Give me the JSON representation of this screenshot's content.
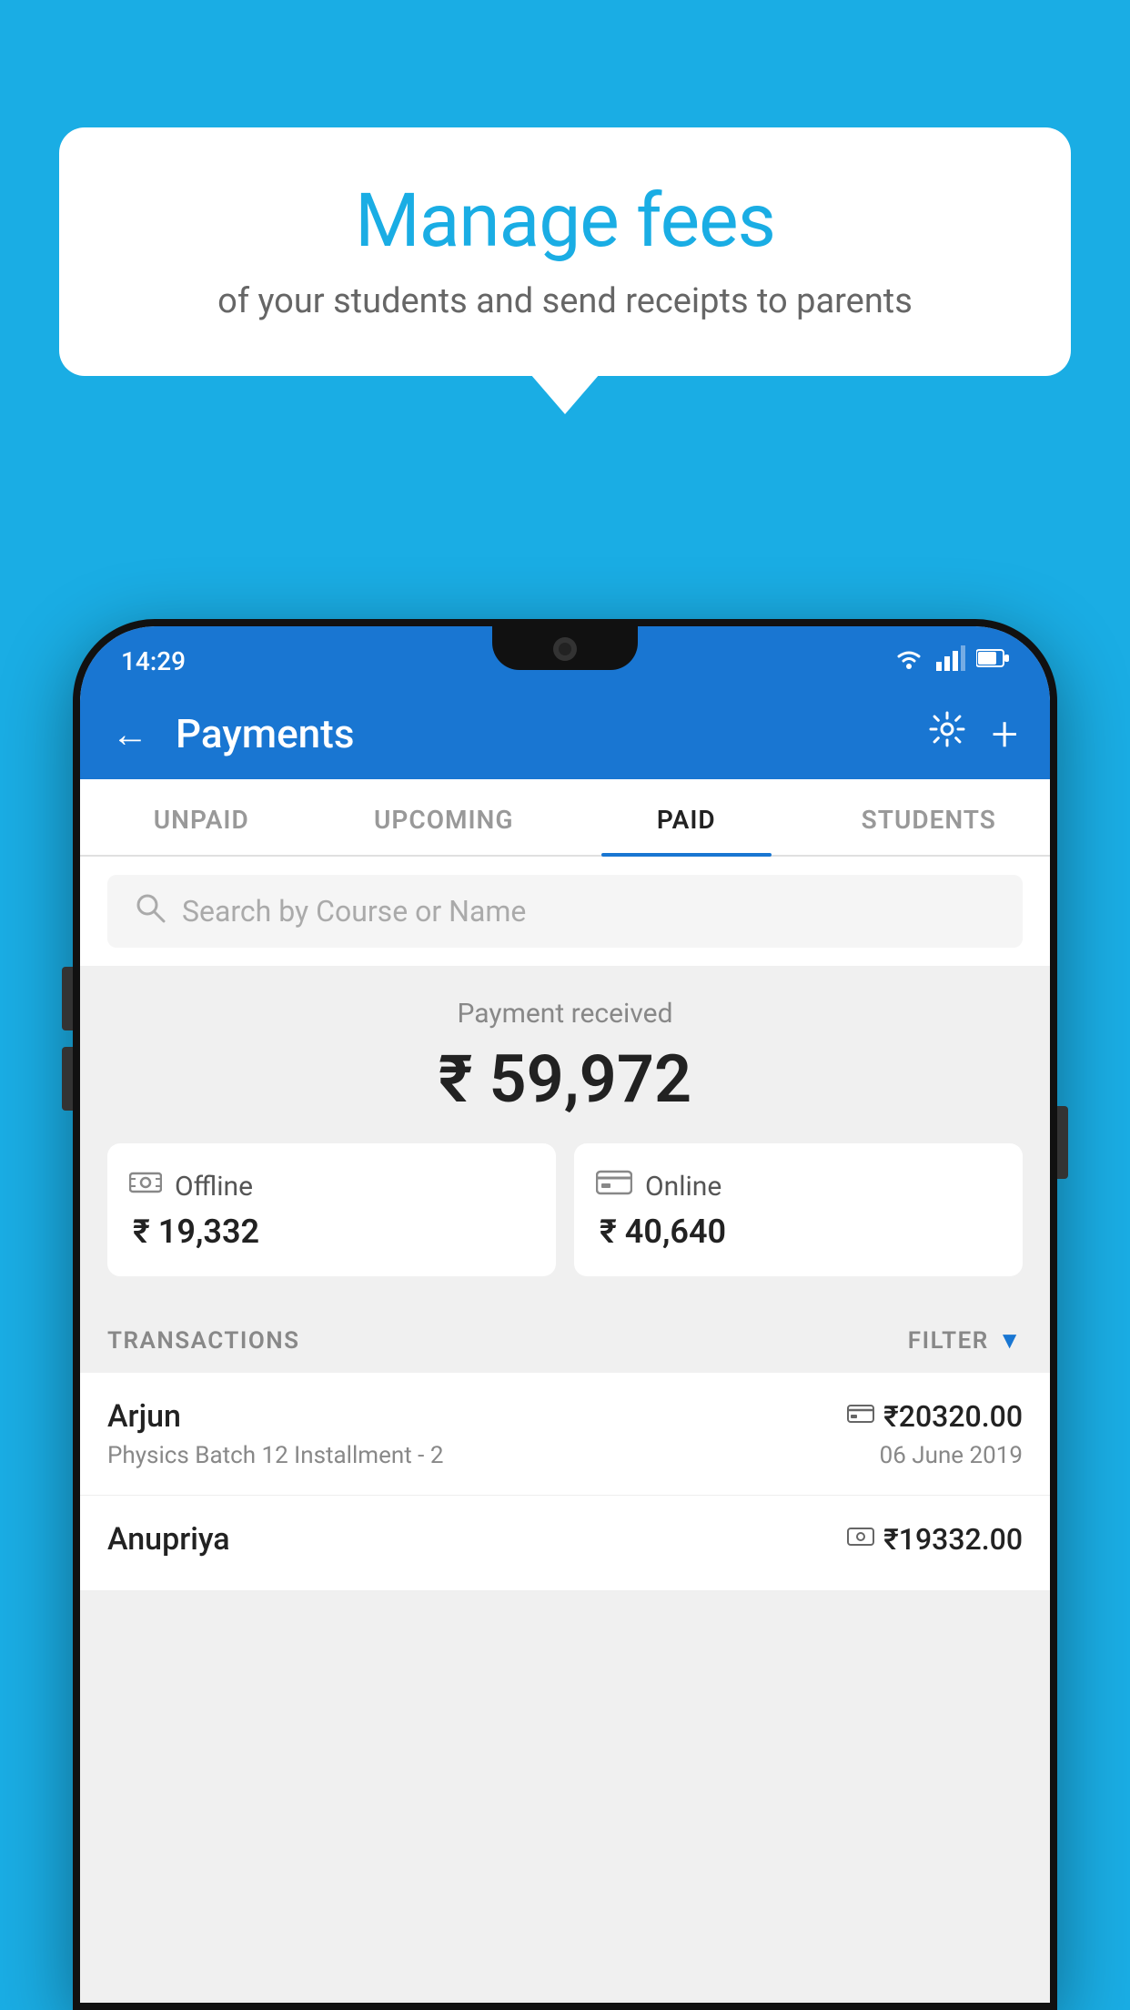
{
  "background_color": "#1AADE4",
  "bubble": {
    "title": "Manage fees",
    "subtitle": "of your students and send receipts to parents"
  },
  "status_bar": {
    "time": "14:29",
    "wifi_icon": "▾",
    "signal_icon": "▲",
    "battery_icon": "▮"
  },
  "app_bar": {
    "title": "Payments",
    "back_icon": "←",
    "settings_icon": "⚙",
    "add_icon": "+"
  },
  "tabs": [
    {
      "label": "UNPAID",
      "active": false
    },
    {
      "label": "UPCOMING",
      "active": false
    },
    {
      "label": "PAID",
      "active": true
    },
    {
      "label": "STUDENTS",
      "active": false
    }
  ],
  "search": {
    "placeholder": "Search by Course or Name"
  },
  "payment_summary": {
    "label": "Payment received",
    "total": "₹ 59,972",
    "offline": {
      "label": "Offline",
      "amount": "₹ 19,332"
    },
    "online": {
      "label": "Online",
      "amount": "₹ 40,640"
    }
  },
  "transactions": {
    "section_label": "TRANSACTIONS",
    "filter_label": "FILTER",
    "items": [
      {
        "name": "Arjun",
        "amount": "₹20320.00",
        "course": "Physics Batch 12 Installment - 2",
        "date": "06 June 2019",
        "payment_type": "card"
      },
      {
        "name": "Anupriya",
        "amount": "₹19332.00",
        "course": "",
        "date": "",
        "payment_type": "cash"
      }
    ]
  }
}
